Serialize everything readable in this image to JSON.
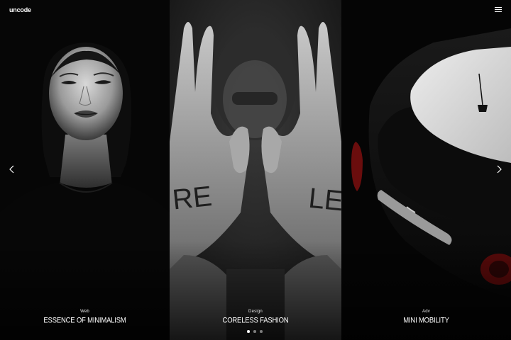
{
  "brand": {
    "logo_text": "uncode"
  },
  "header": {
    "menu_icon": "hamburger-menu-icon"
  },
  "navigation": {
    "prev_icon": "chevron-left-icon",
    "next_icon": "chevron-right-icon"
  },
  "slides": [
    {
      "category": "Web",
      "title": "ESSENCE OF MINIMALISM",
      "image": "portrait-woman-black-and-white"
    },
    {
      "category": "Design",
      "title": "CORELESS FASHION",
      "image": "hands-over-face-black-and-white"
    },
    {
      "category": "Adv",
      "title": "MINI MOBILITY",
      "image": "car-roof-top-view-dark"
    }
  ],
  "pagination": {
    "count": 3,
    "active_index": 0
  },
  "colors": {
    "background": "#0a0a0a",
    "text": "#ffffff",
    "dot_inactive": "#7c7c7c",
    "dot_active": "#ffffff"
  }
}
